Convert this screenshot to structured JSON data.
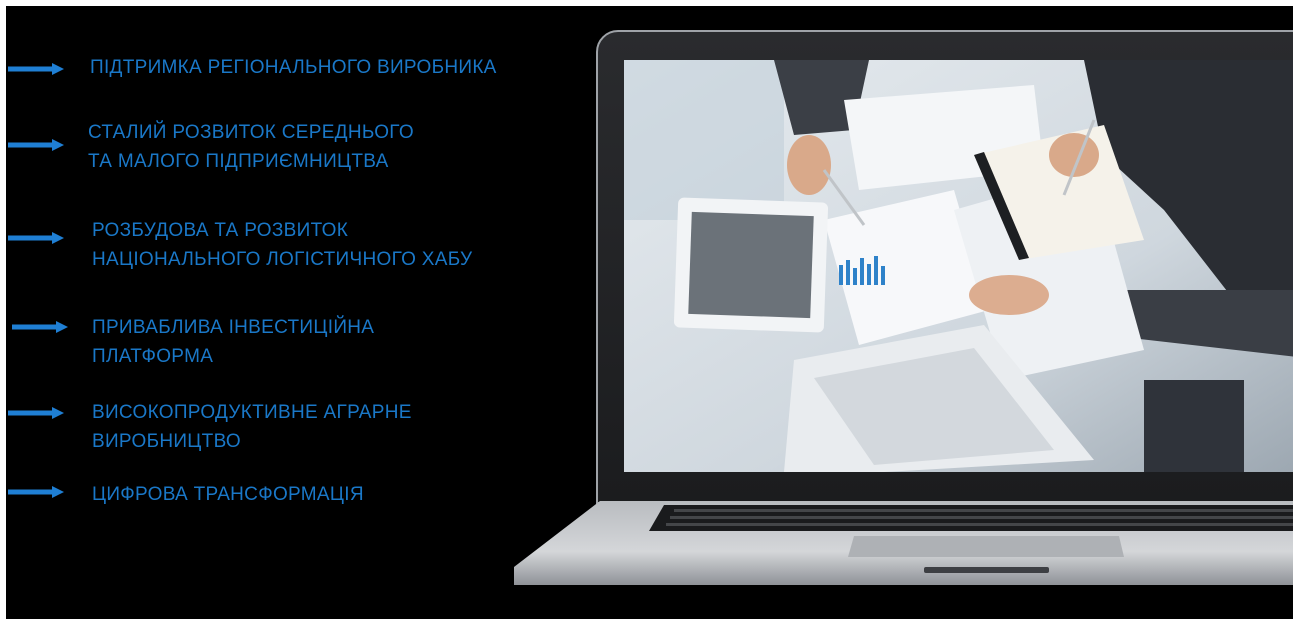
{
  "items": [
    {
      "lines": [
        "ПІДТРИМКА РЕГІОНАЛЬНОГО ВИРОБНИКА"
      ]
    },
    {
      "lines": [
        "СТАЛИЙ РОЗВИТОК СЕРЕДНЬОГО",
        "ТА МАЛОГО ПІДПРИЄМНИЦТВА"
      ]
    },
    {
      "lines": [
        "РОЗБУДОВА ТА РОЗВИТОК",
        "НАЦІОНАЛЬНОГО ЛОГІСТИЧНОГО ХАБУ"
      ]
    },
    {
      "lines": [
        "ПРИВАБЛИВА ІНВЕСТИЦІЙНА",
        "ПЛАТФОРМА"
      ]
    },
    {
      "lines": [
        "ВИСОКОПРОДУКТИВНЕ АГРАРНЕ",
        "ВИРОБНИЦТВО"
      ]
    },
    {
      "lines": [
        "ЦИФРОВА ТРАНСФОРМАЦІЯ"
      ]
    }
  ],
  "colors": {
    "background": "#000000",
    "accent": "#1a78c8",
    "arrow": "#1f7fd4"
  },
  "icons": {
    "bullet": "arrow-right-icon",
    "illustration": "laptop-icon"
  }
}
